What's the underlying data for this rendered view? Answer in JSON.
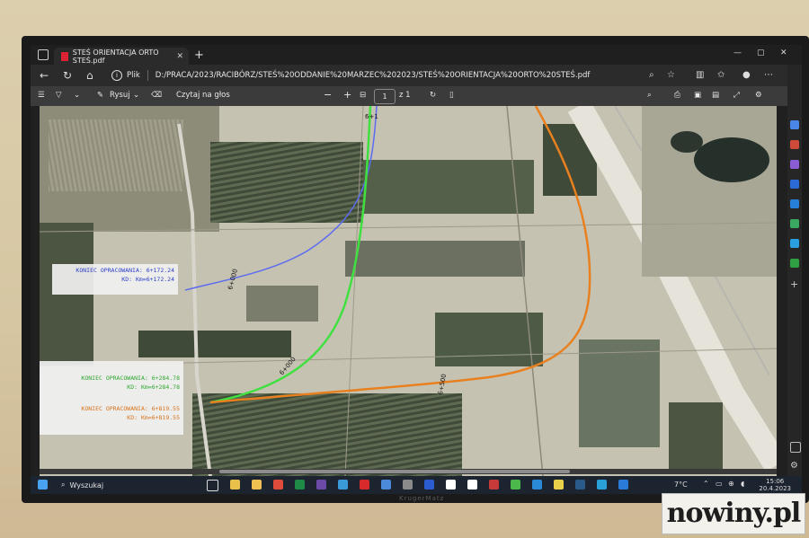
{
  "browser": {
    "tab_title": "STEŚ ORIENTACJA ORTO STEŚ.pdf",
    "file_label": "Plik",
    "url": "D:/PRACA/2023/RACIBÓRZ/STEŚ%20ODDANIE%20MARZEC%202023/STEŚ%20ORIENTACJA%20ORTO%20STEŚ.pdf"
  },
  "pdf_toolbar": {
    "draw_label": "Rysuj",
    "read_aloud_label": "Czytaj na głos",
    "zoom_out": "−",
    "zoom_in": "+",
    "page_number": "1",
    "page_total": "z 1"
  },
  "annotations": {
    "blue": {
      "line1": "KONIEC OPRACOWANIA: 6+172.24",
      "line2": "KD: Km=6+172.24",
      "color": "#2c3fc8"
    },
    "green": {
      "line1": "KONIEC OPRACOWANIA: 6+284.78",
      "line2": "KD: Km=6+284.78",
      "color": "#2ea62e"
    },
    "orange": {
      "line1": "KONIEC OPRACOWANIA: 6+819.55",
      "line2": "KD: Km=6+819.55",
      "color": "#d8731c"
    },
    "station_top": "6+1",
    "station_blue": "6+000",
    "station_green": "6+000",
    "station_orange": "6+500"
  },
  "taskbar": {
    "search_placeholder": "Wyszukaj",
    "temperature": "7°C",
    "time": "15:06",
    "date": "20.4.2023"
  },
  "tv_brand": "KrugerMatz",
  "watermark": "nowiny.pl"
}
